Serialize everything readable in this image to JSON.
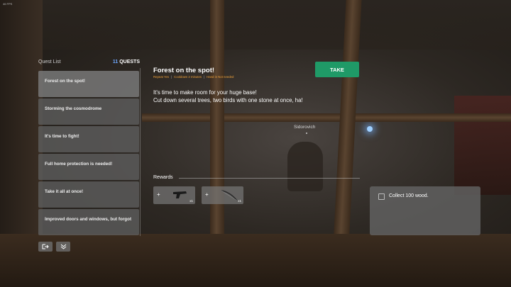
{
  "hud": {
    "fps": "46 FPS"
  },
  "quest_panel": {
    "title": "Quest List",
    "count": "11",
    "count_label": "QUESTS",
    "items": [
      {
        "label": "Forest on the spot!"
      },
      {
        "label": "Storming the cosmodrome"
      },
      {
        "label": "It's time to fight!"
      },
      {
        "label": "Full home protection is needed!"
      },
      {
        "label": "Take it all at once!"
      },
      {
        "label": "Improved doors and windows, but forgot"
      }
    ]
  },
  "quest": {
    "title": "Forest on the spot!",
    "meta": {
      "repeat": "Repeat Yes",
      "cooldown": "Cooldown 2 minutes",
      "hand_in": "Hand in Not needed"
    },
    "description_line1": "It's time to make room for your huge base!",
    "description_line2": "Cut down several trees, two birds with one stone at once, ha!",
    "take_label": "TAKE"
  },
  "npc": {
    "name": "Sidorovich"
  },
  "rewards": {
    "label": "Rewards",
    "items": [
      {
        "icon": "pistol-icon",
        "plus": "+",
        "qty": "x1"
      },
      {
        "icon": "bow-icon",
        "plus": "+",
        "qty": "x1"
      }
    ]
  },
  "tasks": [
    {
      "text": "Collect 100 wood.",
      "done": false
    }
  ],
  "colors": {
    "accent_green": "#1f9a67",
    "meta_orange": "#f0a23a",
    "count_blue": "#6fa8ff"
  }
}
